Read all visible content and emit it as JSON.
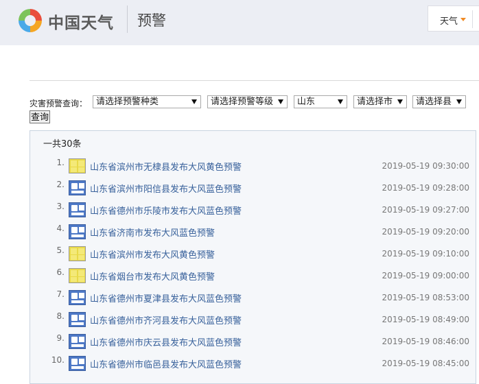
{
  "header": {
    "brand": "中国天气",
    "section_title": "预警",
    "dropdown_label": "天气"
  },
  "filters": {
    "label": "灾害预警查询：",
    "type_select": "请选择预警种类",
    "level_select": "请选择预警等级",
    "province_select": "山东",
    "city_select": "请选择市",
    "county_select": "请选择县",
    "query_button": "查询"
  },
  "list": {
    "total": "一共30条",
    "items": [
      {
        "num": "1.",
        "icon": "yellow-wind-warning-icon",
        "title": "山东省滨州市无棣县发布大风黄色预警",
        "time": "2019-05-19 09:30:00"
      },
      {
        "num": "2.",
        "icon": "blue-wind-warning-icon",
        "title": "山东省滨州市阳信县发布大风蓝色预警",
        "time": "2019-05-19 09:28:00"
      },
      {
        "num": "3.",
        "icon": "blue-wind-warning-icon",
        "title": "山东省德州市乐陵市发布大风蓝色预警",
        "time": "2019-05-19 09:27:00"
      },
      {
        "num": "4.",
        "icon": "blue-wind-warning-icon",
        "title": "山东省济南市发布大风蓝色预警",
        "time": "2019-05-19 09:20:00"
      },
      {
        "num": "5.",
        "icon": "yellow-wind-warning-icon",
        "title": "山东省滨州市发布大风黄色预警",
        "time": "2019-05-19 09:10:00"
      },
      {
        "num": "6.",
        "icon": "yellow-wind-warning-icon",
        "title": "山东省烟台市发布大风黄色预警",
        "time": "2019-05-19 09:00:00"
      },
      {
        "num": "7.",
        "icon": "blue-wind-warning-icon",
        "title": "山东省德州市夏津县发布大风蓝色预警",
        "time": "2019-05-19 08:53:00"
      },
      {
        "num": "8.",
        "icon": "blue-wind-warning-icon",
        "title": "山东省德州市齐河县发布大风蓝色预警",
        "time": "2019-05-19 08:49:00"
      },
      {
        "num": "9.",
        "icon": "blue-wind-warning-icon",
        "title": "山东省德州市庆云县发布大风蓝色预警",
        "time": "2019-05-19 08:46:00"
      },
      {
        "num": "10.",
        "icon": "blue-wind-warning-icon",
        "title": "山东省德州市临邑县发布大风蓝色预警",
        "time": "2019-05-19 08:45:00"
      }
    ]
  }
}
